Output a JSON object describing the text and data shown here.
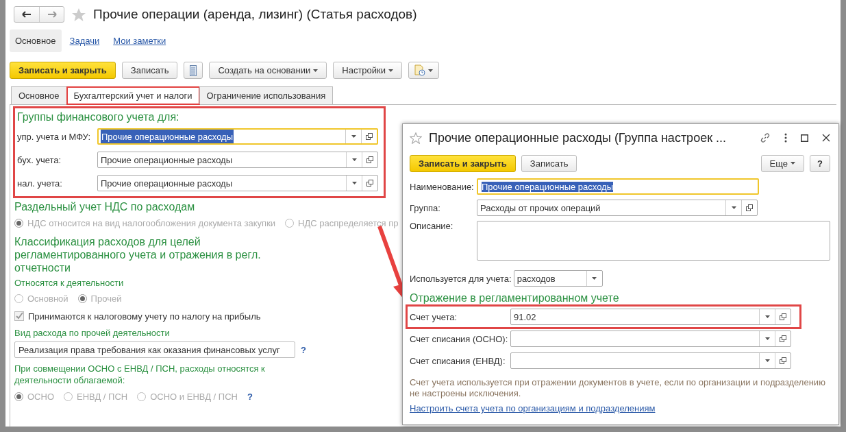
{
  "title": "Прочие операции (аренда, лизинг) (Статья расходов)",
  "section_tabs": [
    {
      "label": "Основное",
      "selected": true
    },
    {
      "label": "Задачи",
      "selected": false
    },
    {
      "label": "Мои заметки",
      "selected": false
    }
  ],
  "toolbar": [
    {
      "kind": "primary",
      "label": "Записать и закрыть"
    },
    {
      "kind": "default",
      "label": "Записать"
    },
    {
      "kind": "icon"
    },
    {
      "kind": "dropdown",
      "label": "Создать на основании"
    },
    {
      "kind": "dropdown",
      "label": "Настройки"
    },
    {
      "kind": "icon-menu"
    }
  ],
  "tabs": [
    {
      "label": "Основное",
      "selected": false,
      "highlighted": false
    },
    {
      "label": "Бухгалтерский учет и налоги",
      "selected": true,
      "highlighted": true
    },
    {
      "label": "Ограничение использования",
      "selected": false,
      "highlighted": false
    }
  ],
  "groups": {
    "title": "Группы финансового учета для:",
    "highlighted": true,
    "fields": [
      {
        "label": "упр. учета и МФУ:",
        "value": "Прочие операционные расходы",
        "focused": true
      },
      {
        "label": "бух. учета:",
        "value": "Прочие операционные расходы",
        "focused": false
      },
      {
        "label": "нал. учета:",
        "value": "Прочие операционные расходы",
        "focused": false
      }
    ]
  },
  "vat": {
    "title": "Раздельный учет НДС по расходам",
    "disabled": true,
    "options": [
      {
        "label": "НДС относится на вид налогообложения документа закупки",
        "selected": true
      },
      {
        "label": "НДС распределяется пр",
        "selected": false
      }
    ]
  },
  "classification": {
    "title": "Классификация расходов для целей регламентированного учета и отражения в регл. отчетности",
    "activity": {
      "label": "Относятся к деятельности",
      "disabled": true,
      "options": [
        {
          "label": "Основной",
          "selected": false
        },
        {
          "label": "Прочей",
          "selected": true
        }
      ]
    },
    "profit_tax": {
      "label": "Принимаются к налоговому учету по налогу на прибыль",
      "checked": true,
      "disabled": true
    },
    "expense_kind": {
      "label": "Вид расхода по прочей деятельности",
      "value": "Реализация права требования как оказания финансовых услуг",
      "help": "?"
    },
    "combination": {
      "label": "При совмещении ОСНО с ЕНВД / ПСН, расходы относятся к деятельности облагаемой:",
      "disabled": true,
      "options": [
        {
          "label": "ОСНО",
          "selected": true
        },
        {
          "label": "ЕНВД / ПСН",
          "selected": false
        },
        {
          "label": "ОСНО и ЕНВД / ПСН",
          "selected": false
        }
      ],
      "help": "?"
    }
  },
  "popup": {
    "title": "Прочие операционные расходы (Группа настроек ...",
    "buttons": [
      {
        "kind": "primary",
        "label": "Записать и закрыть"
      },
      {
        "kind": "default",
        "label": "Записать"
      }
    ],
    "more": "Еще",
    "help": "?",
    "name": {
      "label": "Наименование:",
      "value": "Прочие операционные расходы",
      "focused": true
    },
    "group": {
      "label": "Группа:",
      "value": "Расходы от прочих операций"
    },
    "description": {
      "label": "Описание:"
    },
    "used_for": {
      "label": "Используется для учета:",
      "value": "расходов"
    },
    "reflection_title": "Отражение в регламентированном учете",
    "accounts": [
      {
        "label": "Счет учета:",
        "value": "91.02",
        "highlighted": true
      },
      {
        "label": "Счет списания (ОСНО):",
        "highlighted": false
      },
      {
        "label": "Счет списания (ЕНВД):",
        "highlighted": false
      }
    ],
    "note": "Счет учета используется при отражении документов в учете, если по организации и подразделению не настроены исключения.",
    "link": "Настроить счета учета по организациям и подразделениям"
  }
}
